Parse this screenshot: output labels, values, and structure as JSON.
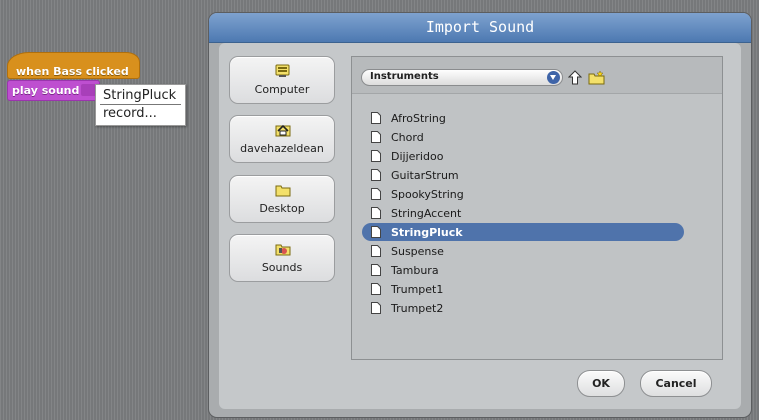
{
  "script_area": {
    "hat_block": "when Bass clicked",
    "sound_block": "play sound",
    "menu": [
      "StringPluck",
      "record..."
    ]
  },
  "dialog": {
    "title": "Import Sound",
    "places": [
      {
        "label": "Computer",
        "icon": "computer-icon"
      },
      {
        "label": "davehazeldean",
        "icon": "home-icon"
      },
      {
        "label": "Desktop",
        "icon": "folder-icon"
      },
      {
        "label": "Sounds",
        "icon": "sounds-folder-icon"
      }
    ],
    "folder_select": "Instruments",
    "files": [
      "AfroString",
      "Chord",
      "Dijjeridoo",
      "GuitarStrum",
      "SpookyString",
      "StringAccent",
      "StringPluck",
      "Suspense",
      "Tambura",
      "Trumpet1",
      "Trumpet2"
    ],
    "selected_file": "StringPluck",
    "ok_label": "OK",
    "cancel_label": "Cancel"
  },
  "colors": {
    "hat_block": "#d8901d",
    "sound_block": "#be4fd0",
    "title_bar": "#5f87bd",
    "selection": "#4f73ab"
  }
}
